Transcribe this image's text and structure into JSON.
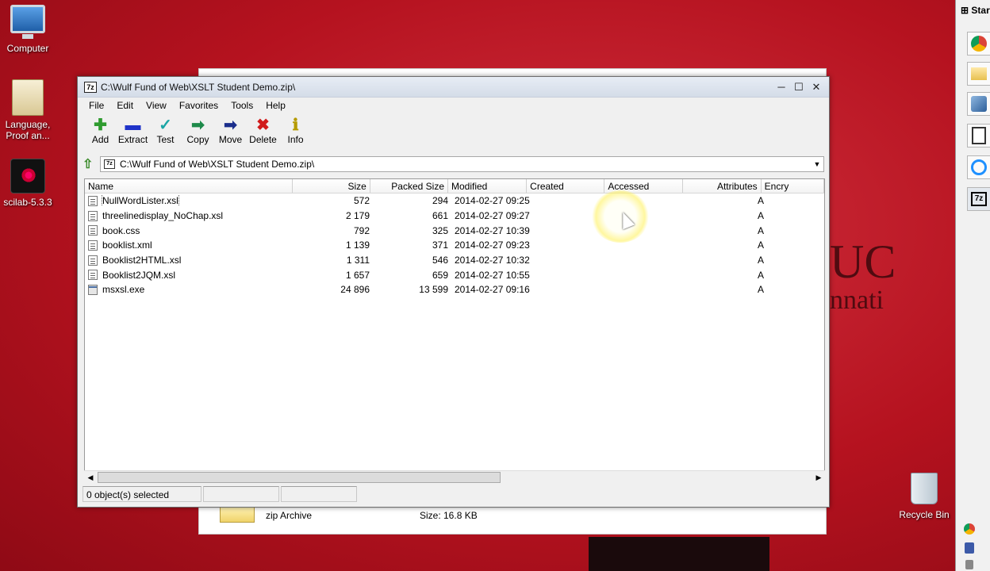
{
  "desktop": {
    "icons": [
      {
        "label": "Computer"
      },
      {
        "label": "Language,\nProof an..."
      },
      {
        "label": "scilab-5.3.3"
      },
      {
        "label": "Recycle Bin"
      }
    ],
    "start_label": "Star"
  },
  "background_window": {
    "type_label": "zip Archive",
    "size_label": "Size: 16.8 KB"
  },
  "brand": {
    "logo_text": "UC",
    "logo_sub": "nnati"
  },
  "window": {
    "title": "C:\\Wulf Fund of Web\\XSLT Student Demo.zip\\",
    "app_badge": "7z",
    "menu": [
      "File",
      "Edit",
      "View",
      "Favorites",
      "Tools",
      "Help"
    ],
    "toolbar": [
      {
        "label": "Add",
        "icon": "add-icon",
        "color": "#2e9b2e"
      },
      {
        "label": "Extract",
        "icon": "extract-icon",
        "color": "#1f33c9"
      },
      {
        "label": "Test",
        "icon": "test-icon",
        "color": "#1aa5a5"
      },
      {
        "label": "Copy",
        "icon": "copy-icon",
        "color": "#1e8a4a"
      },
      {
        "label": "Move",
        "icon": "move-icon",
        "color": "#1a2e8c"
      },
      {
        "label": "Delete",
        "icon": "delete-icon",
        "color": "#d11b1b"
      },
      {
        "label": "Info",
        "icon": "info-icon",
        "color": "#b59a00"
      }
    ],
    "address": "C:\\Wulf Fund of Web\\XSLT Student Demo.zip\\",
    "columns": [
      "Name",
      "Size",
      "Packed Size",
      "Modified",
      "Created",
      "Accessed",
      "Attributes",
      "Encry"
    ],
    "files": [
      {
        "name": "NullWordLister.xsl",
        "size": "572",
        "packed": "294",
        "modified": "2014-02-27 09:25",
        "attr": "A"
      },
      {
        "name": "threelinedisplay_NoChap.xsl",
        "size": "2 179",
        "packed": "661",
        "modified": "2014-02-27 09:27",
        "attr": "A"
      },
      {
        "name": "book.css",
        "size": "792",
        "packed": "325",
        "modified": "2014-02-27 10:39",
        "attr": "A"
      },
      {
        "name": "booklist.xml",
        "size": "1 139",
        "packed": "371",
        "modified": "2014-02-27 09:23",
        "attr": "A"
      },
      {
        "name": "Booklist2HTML.xsl",
        "size": "1 311",
        "packed": "546",
        "modified": "2014-02-27 10:32",
        "attr": "A"
      },
      {
        "name": "Booklist2JQM.xsl",
        "size": "1 657",
        "packed": "659",
        "modified": "2014-02-27 10:55",
        "attr": "A"
      },
      {
        "name": "msxsl.exe",
        "size": "24 896",
        "packed": "13 599",
        "modified": "2014-02-27 09:16",
        "attr": "A"
      }
    ],
    "status": "0 object(s) selected"
  }
}
